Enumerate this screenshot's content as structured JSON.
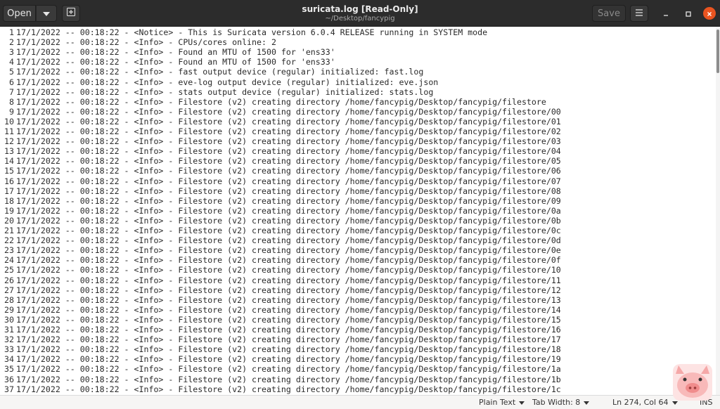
{
  "window": {
    "title": "suricata.log [Read-Only]",
    "subtitle": "~/Desktop/fancypig"
  },
  "headerbar": {
    "open_label": "Open",
    "save_label": "Save"
  },
  "editor": {
    "lines": [
      {
        "n": "1",
        "text": "17/1/2022 -- 00:18:22 - <Notice> - This is Suricata version 6.0.4 RELEASE running in SYSTEM mode"
      },
      {
        "n": "2",
        "text": "17/1/2022 -- 00:18:22 - <Info> - CPUs/cores online: 2"
      },
      {
        "n": "3",
        "text": "17/1/2022 -- 00:18:22 - <Info> - Found an MTU of 1500 for 'ens33'"
      },
      {
        "n": "4",
        "text": "17/1/2022 -- 00:18:22 - <Info> - Found an MTU of 1500 for 'ens33'"
      },
      {
        "n": "5",
        "text": "17/1/2022 -- 00:18:22 - <Info> - fast output device (regular) initialized: fast.log"
      },
      {
        "n": "6",
        "text": "17/1/2022 -- 00:18:22 - <Info> - eve-log output device (regular) initialized: eve.json"
      },
      {
        "n": "7",
        "text": "17/1/2022 -- 00:18:22 - <Info> - stats output device (regular) initialized: stats.log"
      },
      {
        "n": "8",
        "text": "17/1/2022 -- 00:18:22 - <Info> - Filestore (v2) creating directory /home/fancypig/Desktop/fancypig/filestore"
      },
      {
        "n": "9",
        "text": "17/1/2022 -- 00:18:22 - <Info> - Filestore (v2) creating directory /home/fancypig/Desktop/fancypig/filestore/00"
      },
      {
        "n": "10",
        "text": "17/1/2022 -- 00:18:22 - <Info> - Filestore (v2) creating directory /home/fancypig/Desktop/fancypig/filestore/01"
      },
      {
        "n": "11",
        "text": "17/1/2022 -- 00:18:22 - <Info> - Filestore (v2) creating directory /home/fancypig/Desktop/fancypig/filestore/02"
      },
      {
        "n": "12",
        "text": "17/1/2022 -- 00:18:22 - <Info> - Filestore (v2) creating directory /home/fancypig/Desktop/fancypig/filestore/03"
      },
      {
        "n": "13",
        "text": "17/1/2022 -- 00:18:22 - <Info> - Filestore (v2) creating directory /home/fancypig/Desktop/fancypig/filestore/04"
      },
      {
        "n": "14",
        "text": "17/1/2022 -- 00:18:22 - <Info> - Filestore (v2) creating directory /home/fancypig/Desktop/fancypig/filestore/05"
      },
      {
        "n": "15",
        "text": "17/1/2022 -- 00:18:22 - <Info> - Filestore (v2) creating directory /home/fancypig/Desktop/fancypig/filestore/06"
      },
      {
        "n": "16",
        "text": "17/1/2022 -- 00:18:22 - <Info> - Filestore (v2) creating directory /home/fancypig/Desktop/fancypig/filestore/07"
      },
      {
        "n": "17",
        "text": "17/1/2022 -- 00:18:22 - <Info> - Filestore (v2) creating directory /home/fancypig/Desktop/fancypig/filestore/08"
      },
      {
        "n": "18",
        "text": "17/1/2022 -- 00:18:22 - <Info> - Filestore (v2) creating directory /home/fancypig/Desktop/fancypig/filestore/09"
      },
      {
        "n": "19",
        "text": "17/1/2022 -- 00:18:22 - <Info> - Filestore (v2) creating directory /home/fancypig/Desktop/fancypig/filestore/0a"
      },
      {
        "n": "20",
        "text": "17/1/2022 -- 00:18:22 - <Info> - Filestore (v2) creating directory /home/fancypig/Desktop/fancypig/filestore/0b"
      },
      {
        "n": "21",
        "text": "17/1/2022 -- 00:18:22 - <Info> - Filestore (v2) creating directory /home/fancypig/Desktop/fancypig/filestore/0c"
      },
      {
        "n": "22",
        "text": "17/1/2022 -- 00:18:22 - <Info> - Filestore (v2) creating directory /home/fancypig/Desktop/fancypig/filestore/0d"
      },
      {
        "n": "23",
        "text": "17/1/2022 -- 00:18:22 - <Info> - Filestore (v2) creating directory /home/fancypig/Desktop/fancypig/filestore/0e"
      },
      {
        "n": "24",
        "text": "17/1/2022 -- 00:18:22 - <Info> - Filestore (v2) creating directory /home/fancypig/Desktop/fancypig/filestore/0f"
      },
      {
        "n": "25",
        "text": "17/1/2022 -- 00:18:22 - <Info> - Filestore (v2) creating directory /home/fancypig/Desktop/fancypig/filestore/10"
      },
      {
        "n": "26",
        "text": "17/1/2022 -- 00:18:22 - <Info> - Filestore (v2) creating directory /home/fancypig/Desktop/fancypig/filestore/11"
      },
      {
        "n": "27",
        "text": "17/1/2022 -- 00:18:22 - <Info> - Filestore (v2) creating directory /home/fancypig/Desktop/fancypig/filestore/12"
      },
      {
        "n": "28",
        "text": "17/1/2022 -- 00:18:22 - <Info> - Filestore (v2) creating directory /home/fancypig/Desktop/fancypig/filestore/13"
      },
      {
        "n": "29",
        "text": "17/1/2022 -- 00:18:22 - <Info> - Filestore (v2) creating directory /home/fancypig/Desktop/fancypig/filestore/14"
      },
      {
        "n": "30",
        "text": "17/1/2022 -- 00:18:22 - <Info> - Filestore (v2) creating directory /home/fancypig/Desktop/fancypig/filestore/15"
      },
      {
        "n": "31",
        "text": "17/1/2022 -- 00:18:22 - <Info> - Filestore (v2) creating directory /home/fancypig/Desktop/fancypig/filestore/16"
      },
      {
        "n": "32",
        "text": "17/1/2022 -- 00:18:22 - <Info> - Filestore (v2) creating directory /home/fancypig/Desktop/fancypig/filestore/17"
      },
      {
        "n": "33",
        "text": "17/1/2022 -- 00:18:22 - <Info> - Filestore (v2) creating directory /home/fancypig/Desktop/fancypig/filestore/18"
      },
      {
        "n": "34",
        "text": "17/1/2022 -- 00:18:22 - <Info> - Filestore (v2) creating directory /home/fancypig/Desktop/fancypig/filestore/19"
      },
      {
        "n": "35",
        "text": "17/1/2022 -- 00:18:22 - <Info> - Filestore (v2) creating directory /home/fancypig/Desktop/fancypig/filestore/1a"
      },
      {
        "n": "36",
        "text": "17/1/2022 -- 00:18:22 - <Info> - Filestore (v2) creating directory /home/fancypig/Desktop/fancypig/filestore/1b"
      },
      {
        "n": "37",
        "text": "17/1/2022 -- 00:18:22 - <Info> - Filestore (v2) creating directory /home/fancypig/Desktop/fancypig/filestore/1c"
      }
    ]
  },
  "statusbar": {
    "language": "Plain Text",
    "tab_width": "Tab Width: 8",
    "position": "Ln 274, Col 64",
    "mode": "INS"
  },
  "icons": {
    "open_menu": "chevron-down-icon",
    "new_tab": "new-tab-icon",
    "menu": "hamburger-menu-icon",
    "minimize": "minimize-icon",
    "maximize": "maximize-icon",
    "close": "close-icon",
    "mascot": "pig-logo-icon"
  },
  "colors": {
    "headerbar_bg": "#2c2c2c",
    "close_button": "#e95420",
    "editor_bg": "#ffffff",
    "statusbar_bg": "#f6f5f4"
  }
}
